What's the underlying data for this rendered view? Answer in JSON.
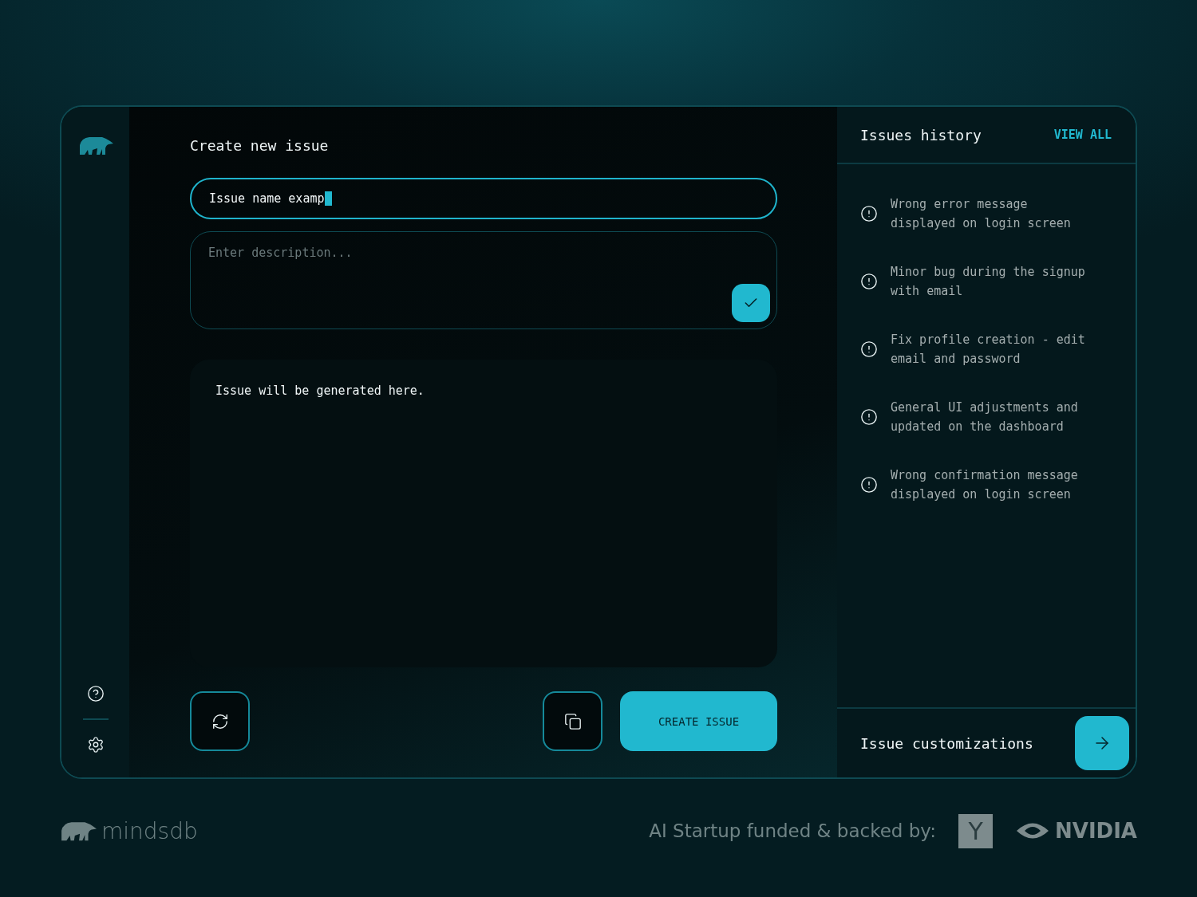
{
  "main": {
    "title": "Create new issue",
    "name_field": {
      "value": "Issue name examp",
      "focused": true
    },
    "description_field": {
      "placeholder": "Enter description..."
    },
    "output": {
      "text": "Issue will be generated here."
    },
    "create_button": "CREATE ISSUE"
  },
  "history": {
    "title": "Issues history",
    "view_all": "VIEW ALL",
    "items": [
      {
        "text": "Wrong error message displayed on login screen"
      },
      {
        "text": "Minor bug during the signup with email"
      },
      {
        "text": "Fix profile creation - edit email and password"
      },
      {
        "text": "General UI adjustments and updated on the dashboard"
      },
      {
        "text": "Wrong confirmation message displayed on login screen"
      }
    ]
  },
  "customizations": {
    "label": "Issue customizations"
  },
  "footer": {
    "brand": "mindsdb",
    "tagline": "AI Startup funded & backed by:",
    "backers": [
      "Y",
      "NVIDIA"
    ]
  }
}
